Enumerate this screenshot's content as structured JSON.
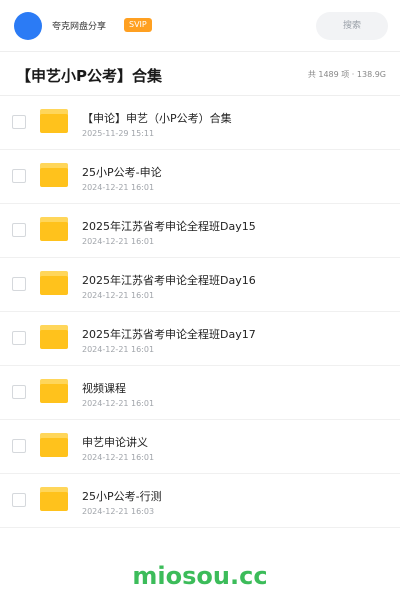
{
  "header": {
    "brand": "夸克网盘分享",
    "badge": "SVIP",
    "search_placeholder": "搜索"
  },
  "page": {
    "title": "【申艺小P公考】合集",
    "meta": "共 1489 项 · 138.9G"
  },
  "items": [
    {
      "name": "【申论】申艺（小P公考）合集",
      "date": "2025-11-29 15:11"
    },
    {
      "name": "25小P公考-申论",
      "date": "2024-12-21 16:01"
    },
    {
      "name": "2025年江苏省考申论全程班Day15",
      "date": "2024-12-21 16:01"
    },
    {
      "name": "2025年江苏省考申论全程班Day16",
      "date": "2024-12-21 16:01"
    },
    {
      "name": "2025年江苏省考申论全程班Day17",
      "date": "2024-12-21 16:01"
    },
    {
      "name": "视频课程",
      "date": "2024-12-21 16:01"
    },
    {
      "name": "申艺申论讲义",
      "date": "2024-12-21 16:01"
    },
    {
      "name": "25小P公考-行测",
      "date": "2024-12-21 16:03"
    }
  ],
  "watermark": "miosou.cc",
  "colors": {
    "avatar": "#2b7bf5",
    "badge": "#ffa021",
    "folder": "#ffc21c",
    "watermark": "#3cbc5a"
  }
}
